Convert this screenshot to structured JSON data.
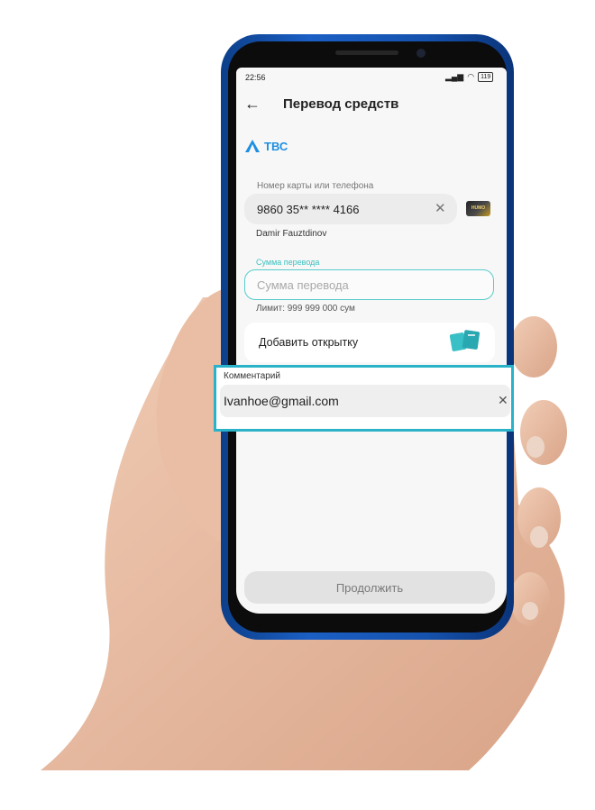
{
  "status_bar": {
    "time": "22:56",
    "battery": "119"
  },
  "header": {
    "title": "Перевод средств"
  },
  "bank": {
    "name": "ТВС"
  },
  "card": {
    "label": "Номер карты или телефона",
    "value": "9860 35** **** 4166",
    "owner": "Damir Fauztdinov",
    "card_brand": "HUMO"
  },
  "amount": {
    "label": "Сумма перевода",
    "placeholder": "Сумма перевода",
    "limit": "Лимит: 999 999 000 сум"
  },
  "postcard": {
    "label": "Добавить открытку"
  },
  "comment": {
    "label": "Комментарий",
    "value": "Ivanhoe@gmail.com"
  },
  "actions": {
    "continue_label": "Продолжить"
  },
  "colors": {
    "accent": "#3cc1c0",
    "highlight": "#2ab3c8",
    "bank_blue": "#1d8fe0",
    "phone_frame": "#1552ad"
  }
}
